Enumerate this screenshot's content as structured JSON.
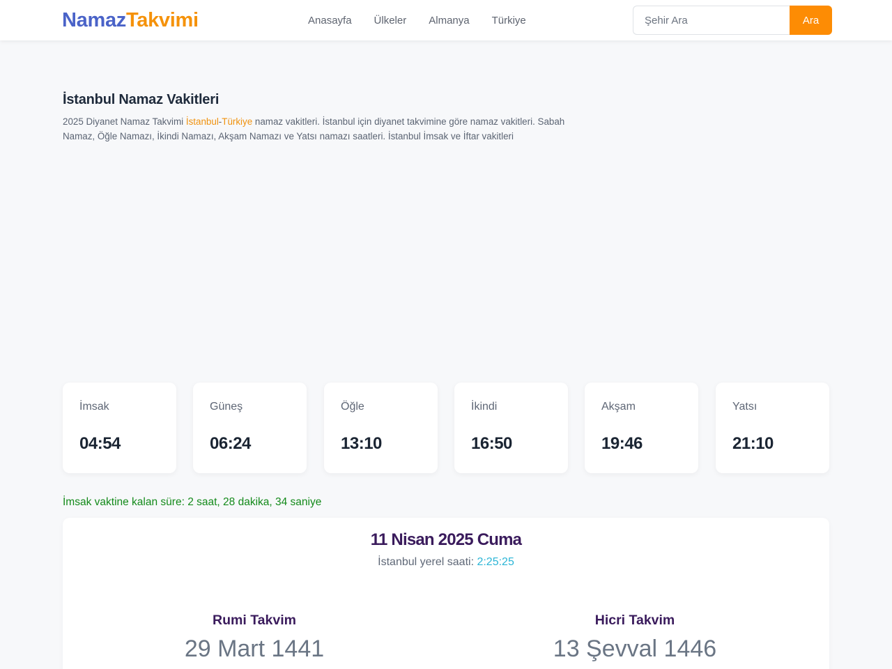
{
  "brand": {
    "part1": "Namaz",
    "part2": "Takvimi"
  },
  "nav": [
    {
      "label": "Anasayfa"
    },
    {
      "label": "Ülkeler"
    },
    {
      "label": "Almanya"
    },
    {
      "label": "Türkiye"
    }
  ],
  "search": {
    "placeholder": "Şehir Ara",
    "button_label": "Ara"
  },
  "page": {
    "title": "İstanbul Namaz Vakitleri",
    "intro_prefix": "2025 Diyanet Namaz Takvimi ",
    "city_link": "İstanbul",
    "separator": "-",
    "country_link": "Türkiye",
    "intro_suffix": " namaz vakitleri. İstanbul için diyanet takvimine göre namaz vakitleri. Sabah Namaz, Öğle Namazı, İkindi Namazı, Akşam Namazı ve Yatsı namazı saatleri. İstanbul İmsak ve İftar vakitleri"
  },
  "prayer_times": [
    {
      "name": "İmsak",
      "time": "04:54"
    },
    {
      "name": "Güneş",
      "time": "06:24"
    },
    {
      "name": "Öğle",
      "time": "13:10"
    },
    {
      "name": "İkindi",
      "time": "16:50"
    },
    {
      "name": "Akşam",
      "time": "19:46"
    },
    {
      "name": "Yatsı",
      "time": "21:10"
    }
  ],
  "countdown": "İmsak vaktine kalan süre: 2 saat, 28 dakika, 34 saniye",
  "date_panel": {
    "date": "11 Nisan 2025 Cuma",
    "local_time_label": "İstanbul yerel saati: ",
    "local_time_value": "2:25:25",
    "rumi": {
      "title": "Rumi Takvim",
      "value": "29 Mart 1441"
    },
    "hicri": {
      "title": "Hicri Takvim",
      "value": "13 Şevval 1446"
    }
  },
  "colors": {
    "brand_blue": "#4a63c8",
    "brand_orange": "#f5920a",
    "button_orange": "#fd8c04",
    "countdown_green": "#138a1a",
    "clock_cyan": "#2bb5d6",
    "heading_purple": "#3a1b5c"
  }
}
